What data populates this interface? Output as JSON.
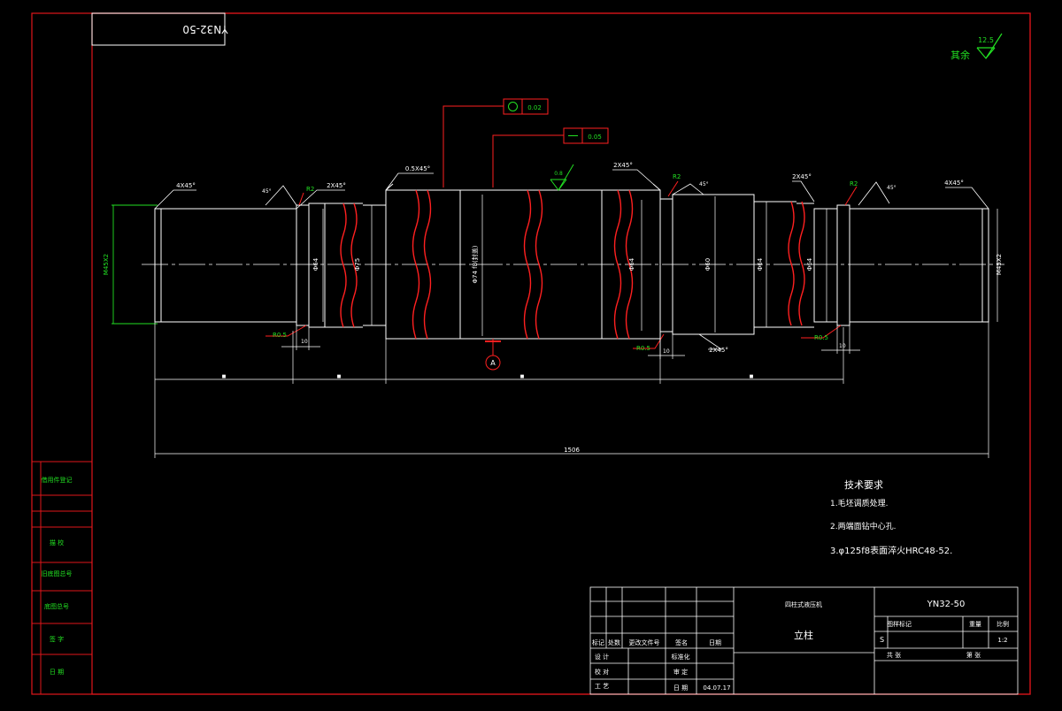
{
  "drawing": {
    "code_box": "YN32-50",
    "roughness_note": "其余",
    "roughness_other": "12.5",
    "roughness_body": "0.8",
    "tolerance_1": "0.02",
    "tolerance_2": "0.05",
    "datum": "A",
    "chamfers": [
      "4X45°",
      "2X45°",
      "0.5X45°",
      "2X45°",
      "2X45°",
      "2X45°",
      "4X45°",
      "2X45°"
    ],
    "radii": [
      "R2",
      "R2",
      "R2",
      "R0.5",
      "R0.5",
      "R0.5"
    ],
    "undercuts": [
      "10",
      "10",
      "10"
    ],
    "small_angles": [
      "45°",
      "45°",
      "45°"
    ],
    "diameters": [
      "M45X2",
      "Φ64",
      "Φ75",
      "Φ74 f8(封盖)",
      "Φ64",
      "Φ60",
      "Φ64",
      "Φ64",
      "M45X2"
    ],
    "segment_dims": [
      "■",
      "■",
      "■",
      "■"
    ],
    "overall_length": "1506"
  },
  "requirements": {
    "heading": "技术要求",
    "items": [
      "1.毛坯调质处理.",
      "2.两端面钻中心孔.",
      "3.φ125f8表面淬火HRC48-52."
    ]
  },
  "side_table": {
    "rows": [
      "借用件登记",
      "",
      "",
      "描 校",
      "旧底图总号",
      "底图总号",
      "签 字",
      "日 期"
    ]
  },
  "title_block": {
    "company": "YN32-50",
    "material_title": "四柱式液压机",
    "part_name": "立柱",
    "headers": [
      "图样标记",
      "重量",
      "比例"
    ],
    "mark": "S",
    "scale": "1:2",
    "sheet_labels": [
      "共 张",
      "第 张"
    ],
    "left_rows": [
      [
        "标记",
        "处数",
        "更改文件号",
        "签名",
        "日期"
      ],
      [
        "设 计",
        "",
        "标准化",
        "",
        ""
      ],
      [
        "校 对",
        "",
        "审 定",
        "",
        ""
      ],
      [
        "审 核",
        "",
        "",
        "",
        ""
      ],
      [
        "工 艺",
        "",
        "日 期",
        "",
        "04.07.17"
      ]
    ]
  },
  "colors": {
    "frame": "#e0161a",
    "white": "#ffffff",
    "green": "#22e022",
    "red": "#ff2020"
  }
}
